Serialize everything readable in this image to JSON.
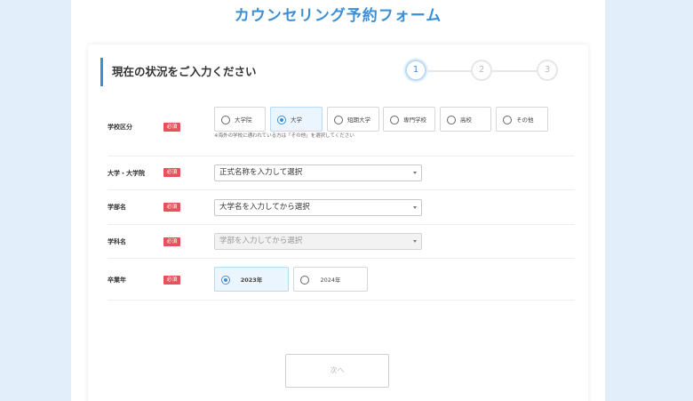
{
  "page_title": "カウンセリング予約フォーム",
  "section_title": "現在の状況をご入力ください",
  "steps": [
    "1",
    "2",
    "3"
  ],
  "required_label": "必須",
  "school_type": {
    "label": "学校区分",
    "options": [
      "大学院",
      "大学",
      "短期大学",
      "専門学校",
      "高校",
      "その他"
    ],
    "selected": "大学",
    "note": "※海外の学校に通われている方は「その他」を選択してください"
  },
  "university": {
    "label": "大学・大学院",
    "value": "正式名称を入力して選択"
  },
  "faculty": {
    "label": "学部名",
    "value": "大学名を入力してから選択"
  },
  "department": {
    "label": "学科名",
    "value": "学部を入力してから選択"
  },
  "graduation": {
    "label": "卒業年",
    "options": [
      "2023年",
      "2024年"
    ],
    "selected": "2023年"
  },
  "next_button": "次へ"
}
